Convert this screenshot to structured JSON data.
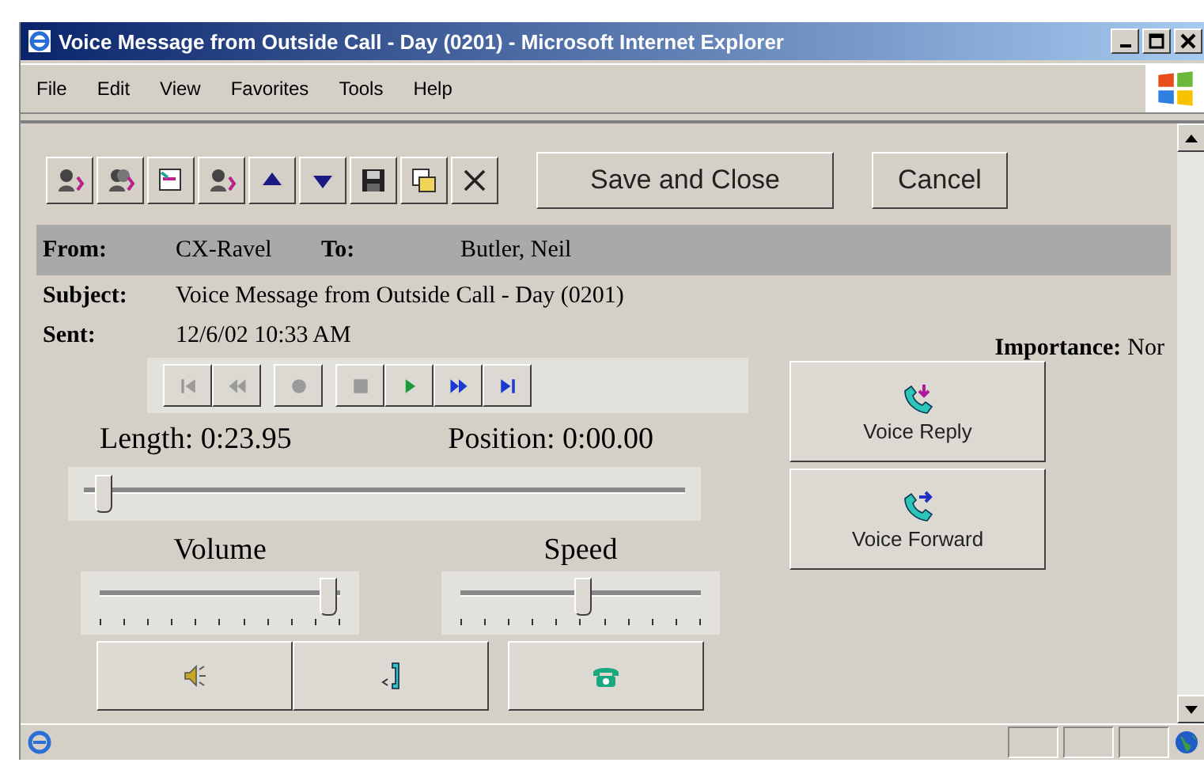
{
  "window": {
    "title": "Voice Message from Outside Call - Day (0201) - Microsoft Internet Explorer"
  },
  "menu": [
    "File",
    "Edit",
    "View",
    "Favorites",
    "Tools",
    "Help"
  ],
  "toolbar": [
    {
      "kind": "reply"
    },
    {
      "kind": "reply-all"
    },
    {
      "kind": "forward"
    },
    {
      "kind": "reply-back"
    },
    {
      "kind": "up"
    },
    {
      "kind": "down"
    },
    {
      "kind": "save"
    },
    {
      "kind": "copy"
    },
    {
      "kind": "delete"
    }
  ],
  "actions": [
    "Save and Close",
    "Cancel"
  ],
  "header": {
    "from_label": "From:",
    "from": "CX-Ravel",
    "to_label": "To:",
    "to": "Butler, Neil",
    "subject_label": "Subject:",
    "subject": "Voice Message from Outside Call - Day (0201)",
    "sent_label": "Sent:",
    "sent": "12/6/02 10:33 AM",
    "importance_label": "Importance:",
    "importance": "Nor"
  },
  "transport": [
    {
      "kind": "start",
      "disabled": true
    },
    {
      "kind": "rewind",
      "disabled": true
    },
    {
      "kind": "record",
      "disabled": true
    },
    {
      "kind": "stop",
      "disabled": true
    },
    {
      "kind": "play",
      "disabled": false
    },
    {
      "kind": "fast-forward",
      "disabled": false
    },
    {
      "kind": "end",
      "disabled": false
    }
  ],
  "length": "Length: 0:23.95",
  "position": "Position: 0:00.00",
  "position_slider": {
    "level": 0.02
  },
  "volume": {
    "label": "Volume",
    "level": 0.97
  },
  "speed": {
    "label": "Speed",
    "level": 0.5
  },
  "call_buttons": [
    {
      "kind": "speaker"
    },
    {
      "kind": "handset"
    },
    {
      "kind": "phone"
    }
  ],
  "voice_buttons": [
    {
      "kind": "reply",
      "label": "Voice Reply"
    },
    {
      "kind": "forward",
      "label": "Voice Forward"
    }
  ]
}
